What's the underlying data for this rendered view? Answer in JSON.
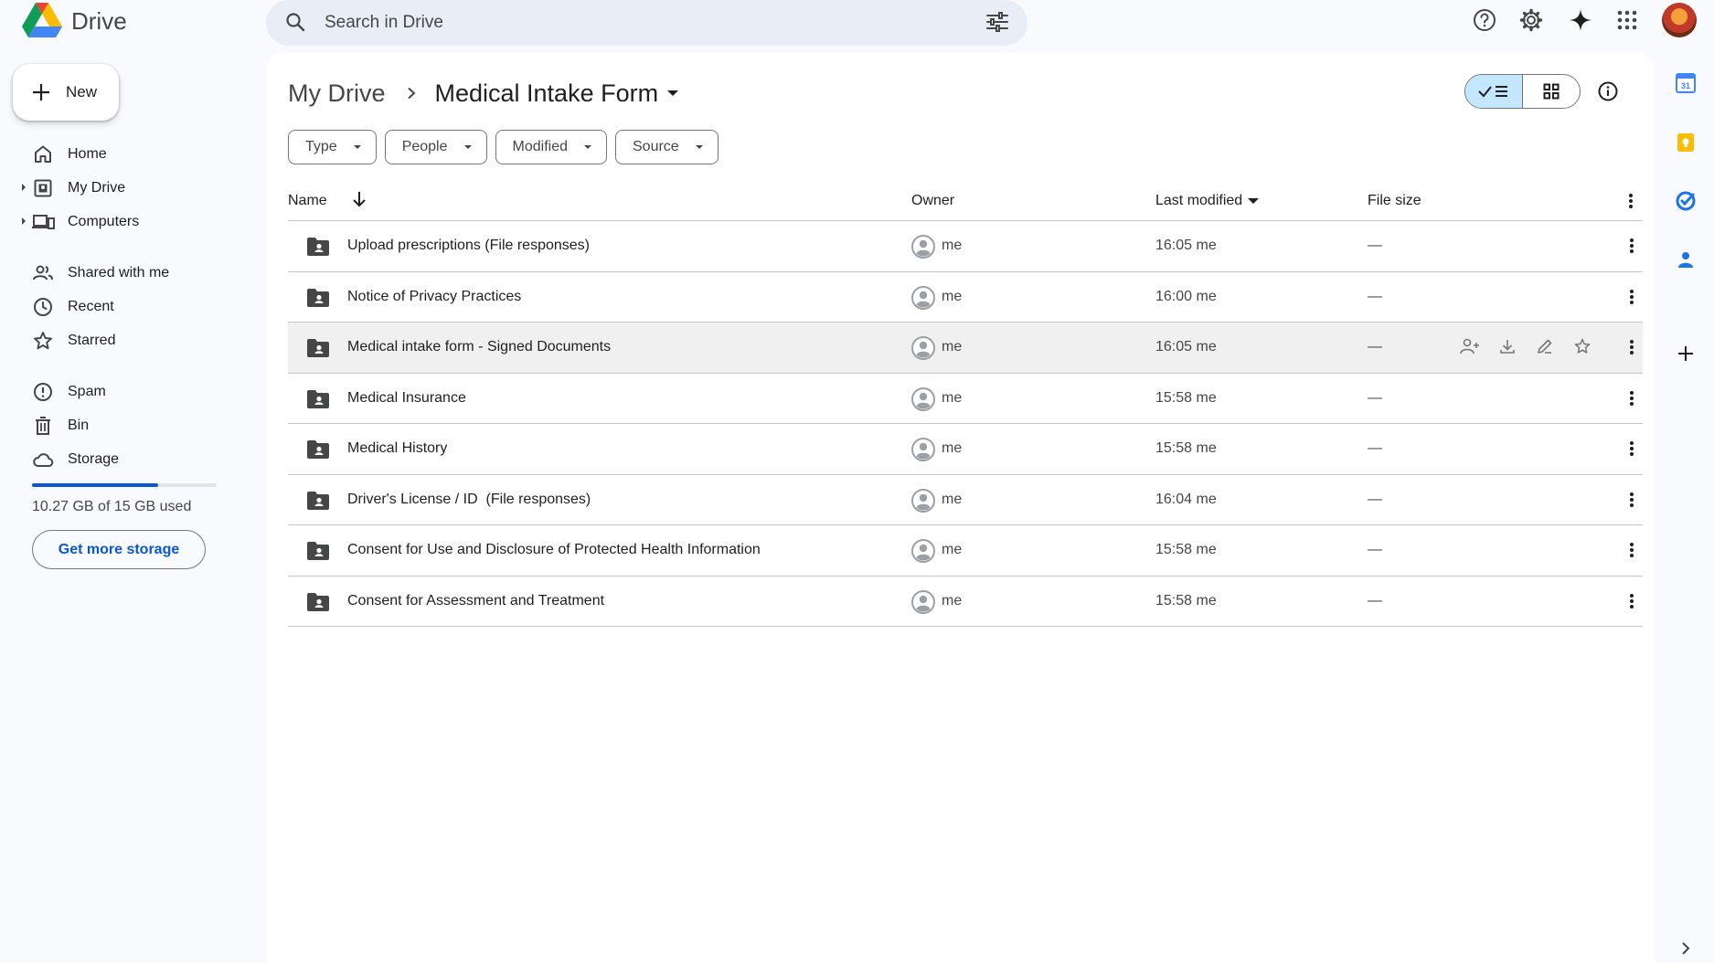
{
  "app": {
    "name": "Drive"
  },
  "search": {
    "placeholder": "Search in Drive"
  },
  "new_button": {
    "label": "New"
  },
  "nav": {
    "items": [
      {
        "label": "Home",
        "icon": "home-icon"
      },
      {
        "label": "My Drive",
        "icon": "my-drive-icon"
      },
      {
        "label": "Computers",
        "icon": "computers-icon"
      },
      {
        "label": "Shared with me",
        "icon": "shared-icon"
      },
      {
        "label": "Recent",
        "icon": "clock-icon"
      },
      {
        "label": "Starred",
        "icon": "star-icon"
      },
      {
        "label": "Spam",
        "icon": "spam-icon"
      },
      {
        "label": "Bin",
        "icon": "bin-icon"
      },
      {
        "label": "Storage",
        "icon": "cloud-icon"
      }
    ]
  },
  "storage": {
    "used_text": "10.27 GB of 15 GB used",
    "used_fraction": 0.685,
    "cta": "Get more storage"
  },
  "breadcrumb": {
    "root": "My Drive",
    "current": "Medical Intake Form"
  },
  "filters": [
    "Type",
    "People",
    "Modified",
    "Source"
  ],
  "table": {
    "columns": {
      "name": "Name",
      "owner": "Owner",
      "modified": "Last modified",
      "size": "File size"
    },
    "rows": [
      {
        "name": "Upload prescriptions (File responses)",
        "owner": "me",
        "modified": "16:05 me",
        "size": "—"
      },
      {
        "name": "Notice of Privacy Practices",
        "owner": "me",
        "modified": "16:00 me",
        "size": "—"
      },
      {
        "name": "Medical intake form - Signed Documents",
        "owner": "me",
        "modified": "16:05 me",
        "size": "—"
      },
      {
        "name": "Medical Insurance",
        "owner": "me",
        "modified": "15:58 me",
        "size": "—"
      },
      {
        "name": "Medical History",
        "owner": "me",
        "modified": "15:58 me",
        "size": "—"
      },
      {
        "name": "Driver's License / ID  (File responses)",
        "owner": "me",
        "modified": "16:04 me",
        "size": "—"
      },
      {
        "name": "Consent for Use and Disclosure of Protected Health Information",
        "owner": "me",
        "modified": "15:58 me",
        "size": "—"
      },
      {
        "name": "Consent for Assessment and Treatment",
        "owner": "me",
        "modified": "15:58 me",
        "size": "—"
      }
    ]
  },
  "colors": {
    "accent": "#0b57d0",
    "selected_view": "#c2e7ff",
    "row_hover": "#f0f0f0"
  }
}
